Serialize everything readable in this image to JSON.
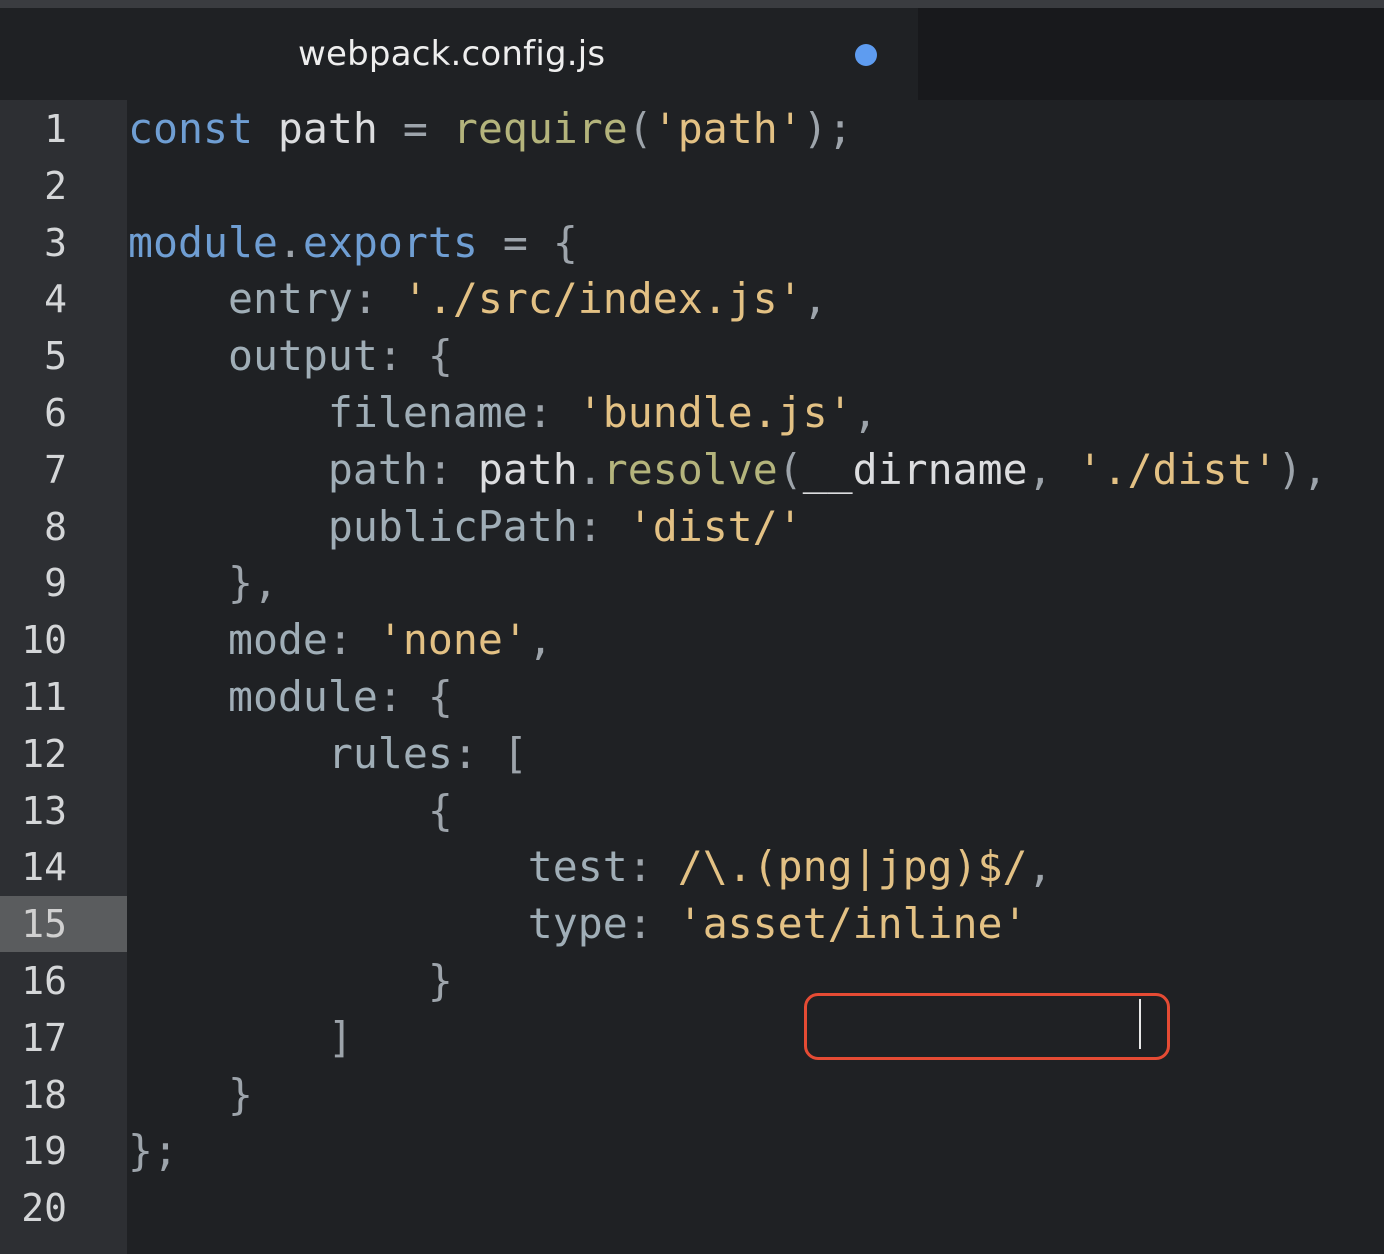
{
  "tab": {
    "title": "webpack.config.js",
    "modified": true
  },
  "editor": {
    "active_line": 15,
    "lines": [
      {
        "num": "1",
        "tokens": [
          {
            "t": "kw",
            "v": "const"
          },
          {
            "t": "plain",
            "v": " path "
          },
          {
            "t": "op",
            "v": "="
          },
          {
            "t": "plain",
            "v": " "
          },
          {
            "t": "fn",
            "v": "require"
          },
          {
            "t": "punc",
            "v": "("
          },
          {
            "t": "str",
            "v": "'path'"
          },
          {
            "t": "punc",
            "v": ");"
          }
        ]
      },
      {
        "num": "2",
        "tokens": []
      },
      {
        "num": "3",
        "tokens": [
          {
            "t": "kw",
            "v": "module"
          },
          {
            "t": "punc",
            "v": "."
          },
          {
            "t": "kw",
            "v": "exports"
          },
          {
            "t": "plain",
            "v": " "
          },
          {
            "t": "op",
            "v": "="
          },
          {
            "t": "plain",
            "v": " "
          },
          {
            "t": "punc",
            "v": "{"
          }
        ]
      },
      {
        "num": "4",
        "tokens": [
          {
            "t": "plain",
            "v": "    "
          },
          {
            "t": "prop",
            "v": "entry"
          },
          {
            "t": "punc",
            "v": ": "
          },
          {
            "t": "str",
            "v": "'./src/index.js'"
          },
          {
            "t": "punc",
            "v": ","
          }
        ]
      },
      {
        "num": "5",
        "tokens": [
          {
            "t": "plain",
            "v": "    "
          },
          {
            "t": "prop",
            "v": "output"
          },
          {
            "t": "punc",
            "v": ": {"
          }
        ]
      },
      {
        "num": "6",
        "tokens": [
          {
            "t": "plain",
            "v": "        "
          },
          {
            "t": "prop",
            "v": "filename"
          },
          {
            "t": "punc",
            "v": ": "
          },
          {
            "t": "str",
            "v": "'bundle.js'"
          },
          {
            "t": "punc",
            "v": ","
          }
        ]
      },
      {
        "num": "7",
        "tokens": [
          {
            "t": "plain",
            "v": "        "
          },
          {
            "t": "prop",
            "v": "path"
          },
          {
            "t": "punc",
            "v": ": "
          },
          {
            "t": "plain",
            "v": "path"
          },
          {
            "t": "punc",
            "v": "."
          },
          {
            "t": "fn",
            "v": "resolve"
          },
          {
            "t": "punc",
            "v": "("
          },
          {
            "t": "plain",
            "v": "__dirname"
          },
          {
            "t": "punc",
            "v": ", "
          },
          {
            "t": "str",
            "v": "'./dist'"
          },
          {
            "t": "punc",
            "v": "),"
          }
        ]
      },
      {
        "num": "8",
        "tokens": [
          {
            "t": "plain",
            "v": "        "
          },
          {
            "t": "prop",
            "v": "publicPath"
          },
          {
            "t": "punc",
            "v": ": "
          },
          {
            "t": "str",
            "v": "'dist/'"
          }
        ]
      },
      {
        "num": "9",
        "tokens": [
          {
            "t": "plain",
            "v": "    "
          },
          {
            "t": "punc",
            "v": "},"
          }
        ]
      },
      {
        "num": "10",
        "tokens": [
          {
            "t": "plain",
            "v": "    "
          },
          {
            "t": "prop",
            "v": "mode"
          },
          {
            "t": "punc",
            "v": ": "
          },
          {
            "t": "str",
            "v": "'none'"
          },
          {
            "t": "punc",
            "v": ","
          }
        ]
      },
      {
        "num": "11",
        "tokens": [
          {
            "t": "plain",
            "v": "    "
          },
          {
            "t": "prop",
            "v": "module"
          },
          {
            "t": "punc",
            "v": ": {"
          }
        ]
      },
      {
        "num": "12",
        "tokens": [
          {
            "t": "plain",
            "v": "        "
          },
          {
            "t": "prop",
            "v": "rules"
          },
          {
            "t": "punc",
            "v": ": ["
          }
        ]
      },
      {
        "num": "13",
        "tokens": [
          {
            "t": "plain",
            "v": "            "
          },
          {
            "t": "punc",
            "v": "{"
          }
        ]
      },
      {
        "num": "14",
        "tokens": [
          {
            "t": "plain",
            "v": "                "
          },
          {
            "t": "prop",
            "v": "test"
          },
          {
            "t": "punc",
            "v": ": "
          },
          {
            "t": "re",
            "v": "/\\.(png|jpg)$/"
          },
          {
            "t": "punc",
            "v": ","
          }
        ]
      },
      {
        "num": "15",
        "tokens": [
          {
            "t": "plain",
            "v": "                "
          },
          {
            "t": "prop",
            "v": "type"
          },
          {
            "t": "punc",
            "v": ": "
          },
          {
            "t": "str",
            "v": "'asset/inline'"
          }
        ]
      },
      {
        "num": "16",
        "tokens": [
          {
            "t": "plain",
            "v": "            "
          },
          {
            "t": "punc",
            "v": "}"
          }
        ]
      },
      {
        "num": "17",
        "tokens": [
          {
            "t": "plain",
            "v": "        "
          },
          {
            "t": "punc",
            "v": "]"
          }
        ]
      },
      {
        "num": "18",
        "tokens": [
          {
            "t": "plain",
            "v": "    "
          },
          {
            "t": "punc",
            "v": "}"
          }
        ]
      },
      {
        "num": "19",
        "tokens": [
          {
            "t": "punc",
            "v": "};"
          }
        ]
      },
      {
        "num": "20",
        "tokens": []
      }
    ]
  },
  "colors": {
    "background": "#1f2124",
    "gutter": "#2d2f33",
    "active_gutter": "#5a5c5e",
    "keyword": "#6f9ed3",
    "string": "#e3c184",
    "function": "#b4b47c",
    "property": "#a0aeb7",
    "modified_dot": "#5e9cf0",
    "highlight_box": "#e54b34"
  }
}
